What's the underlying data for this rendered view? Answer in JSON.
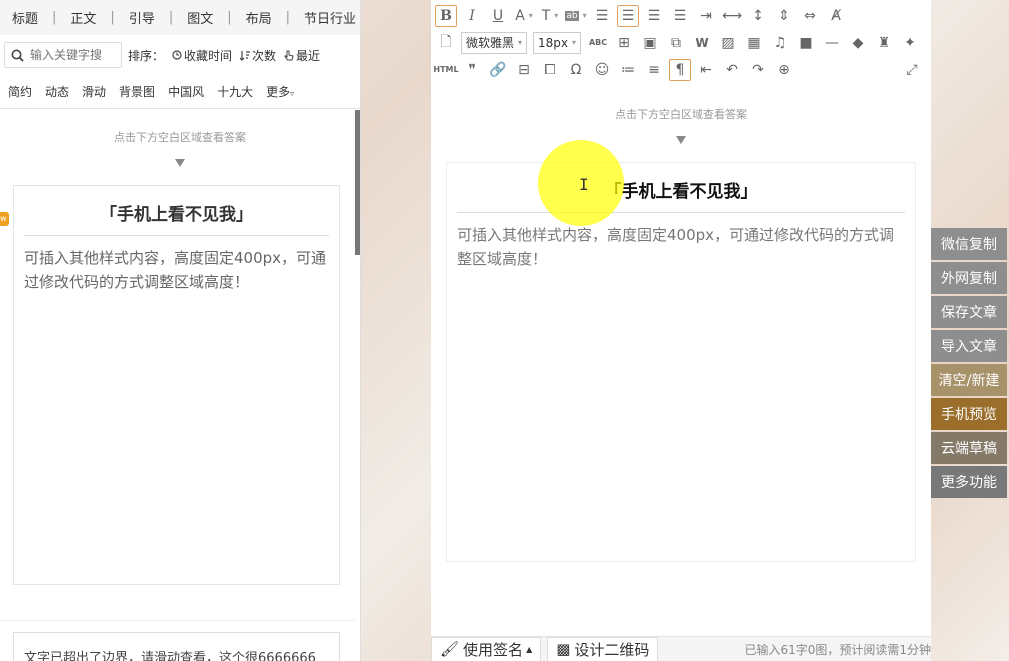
{
  "left_panel": {
    "top_nav": [
      "标题",
      "正文",
      "引导",
      "图文",
      "布局",
      "节日行业"
    ],
    "search": {
      "placeholder": "输入关键字搜"
    },
    "sort_label": "排序：",
    "sort_options": [
      "收藏时间",
      "次数",
      "最近"
    ],
    "categories": [
      "简约",
      "动态",
      "滑动",
      "背景图",
      "中国风",
      "十九大",
      "更多"
    ],
    "hint": "点击下方空白区域查看答案",
    "card": {
      "title": "「手机上看不见我」",
      "body": "可插入其他样式内容，高度固定400px，可通过修改代码的方式调整区域高度！"
    },
    "badge": "w",
    "lower_text": "文字已超出了边界，请滑动查看，这个很6666666"
  },
  "toolbar": {
    "font_name": "微软雅黑",
    "font_size": "18px",
    "html_label": "HTML",
    "abc_label": "ABC"
  },
  "editor": {
    "hint": "点击下方空白区域查看答案",
    "card": {
      "title": "「手机上看不见我」",
      "body": "可插入其他样式内容，高度固定400px，可通过修改代码的方式调整区域高度！"
    },
    "cursor_glyph": "I"
  },
  "bottom_bar": {
    "signature": "使用签名",
    "qrcode": "设计二维码",
    "stats": "已输入61字0图，预计阅读需1分钟"
  },
  "sidebar": {
    "buttons": [
      {
        "label": "微信复制",
        "color": "#8e8e8e"
      },
      {
        "label": "外网复制",
        "color": "#8e8e8e"
      },
      {
        "label": "保存文章",
        "color": "#8e8e8e"
      },
      {
        "label": "导入文章",
        "color": "#8e8e8e"
      },
      {
        "label": "清空/新建",
        "color": "#a8926a"
      },
      {
        "label": "手机预览",
        "color": "#9b6e2c"
      },
      {
        "label": "云端草稿",
        "color": "#857a68"
      },
      {
        "label": "更多功能",
        "color": "#787878"
      }
    ]
  }
}
